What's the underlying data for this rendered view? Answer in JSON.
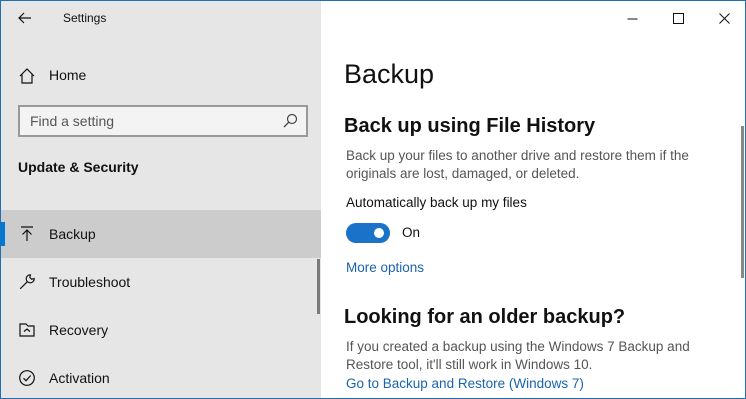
{
  "window": {
    "title": "Settings",
    "controls": {
      "minimize": "minimize-icon",
      "maximize": "maximize-icon",
      "close": "close-icon"
    }
  },
  "sidebar": {
    "home_label": "Home",
    "search": {
      "placeholder": "Find a setting",
      "value": ""
    },
    "section_title": "Update & Security",
    "items": [
      {
        "label": "Backup",
        "icon": "backup-arrow-icon",
        "active": true
      },
      {
        "label": "Troubleshoot",
        "icon": "wrench-icon",
        "active": false
      },
      {
        "label": "Recovery",
        "icon": "recovery-icon",
        "active": false
      },
      {
        "label": "Activation",
        "icon": "activation-check-icon",
        "active": false
      }
    ]
  },
  "main": {
    "page_title": "Backup",
    "file_history": {
      "heading": "Back up using File History",
      "description": "Back up your files to another drive and restore them if the originals are lost, damaged, or deleted.",
      "auto_backup_label": "Automatically back up my files",
      "toggle_state": "On",
      "toggle_on": true,
      "more_options": "More options"
    },
    "older_backup": {
      "heading": "Looking for an older backup?",
      "description": "If you created a backup using the Windows 7 Backup and Restore tool, it'll still work in Windows 10.",
      "link": "Go to Backup and Restore (Windows 7)"
    }
  },
  "colors": {
    "accent": "#0078d7",
    "link": "#1a63b0",
    "toggle_on": "#1a73c8",
    "sidebar_bg": "#e6e6e6",
    "active_item_bg": "#cccccc"
  }
}
